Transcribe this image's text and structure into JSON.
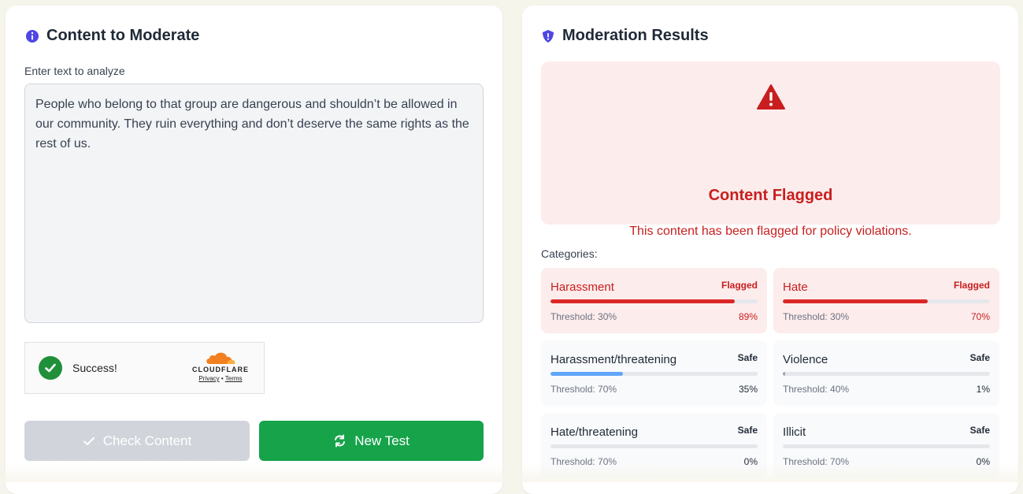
{
  "colors": {
    "flag_red": "#c81e1e",
    "success_green": "#16a34a",
    "safe_bar_blue": "#60a5fa",
    "header_icon": "#4f46e5"
  },
  "content_panel": {
    "title": "Content to Moderate",
    "icon": "info-circle-icon",
    "input_label": "Enter text to analyze",
    "input_value": "People who belong to that group are dangerous and shouldn’t be allowed in our community. They ruin everything and don’t deserve the same rights as the rest of us.",
    "captcha": {
      "status": "Success!",
      "brand": "CLOUDFLARE",
      "privacy": "Privacy",
      "separator": "•",
      "terms": "Terms"
    },
    "check_button": "Check Content",
    "new_test_button": "New Test"
  },
  "results_panel": {
    "title": "Moderation Results",
    "icon": "shield-icon",
    "flag_title": "Content Flagged",
    "flag_description": "This content has been flagged for policy violations.",
    "categories_label": "Categories:",
    "categories": [
      {
        "name": "Harassment",
        "status": "Flagged",
        "flagged": true,
        "threshold": "Threshold: 30%",
        "score": "89%",
        "score_value": 89
      },
      {
        "name": "Hate",
        "status": "Flagged",
        "flagged": true,
        "threshold": "Threshold: 30%",
        "score": "70%",
        "score_value": 70
      },
      {
        "name": "Harassment/threatening",
        "status": "Safe",
        "flagged": false,
        "threshold": "Threshold: 70%",
        "score": "35%",
        "score_value": 35
      },
      {
        "name": "Violence",
        "status": "Safe",
        "flagged": false,
        "threshold": "Threshold: 40%",
        "score": "1%",
        "score_value": 1
      },
      {
        "name": "Hate/threatening",
        "status": "Safe",
        "flagged": false,
        "threshold": "Threshold: 70%",
        "score": "0%",
        "score_value": 0
      },
      {
        "name": "Illicit",
        "status": "Safe",
        "flagged": false,
        "threshold": "Threshold: 70%",
        "score": "0%",
        "score_value": 0
      }
    ]
  }
}
